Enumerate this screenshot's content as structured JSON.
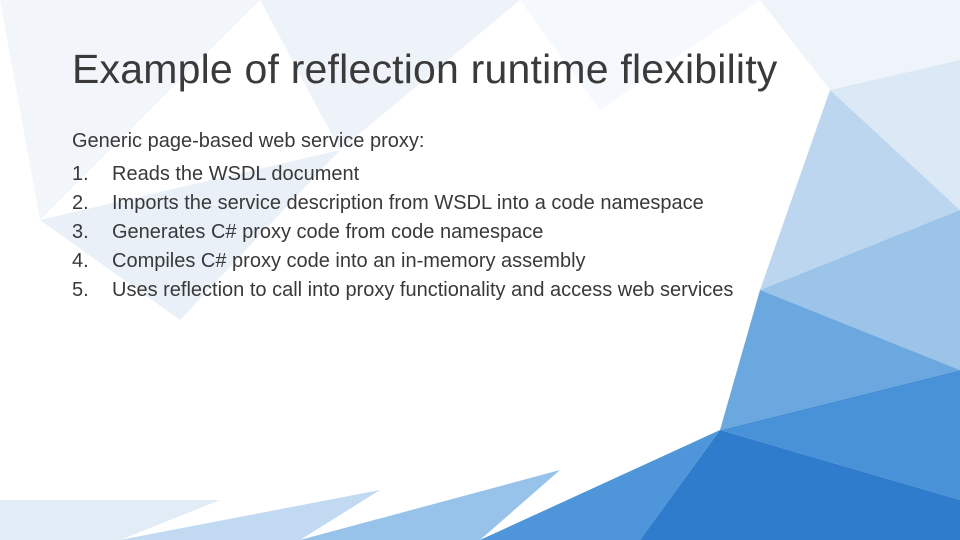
{
  "slide": {
    "title": "Example of reflection runtime flexibility",
    "intro": "Generic page-based web service proxy:",
    "items": [
      "Reads the WSDL document",
      "Imports the service description from WSDL into a code namespace",
      "Generates C# proxy code from code namespace",
      "Compiles C# proxy code into an in-memory assembly",
      "Uses reflection to call into proxy functionality and access web services"
    ],
    "theme": {
      "facet_light": "#e8eef6",
      "facet_mid": "#cfe0f2",
      "facet_blue1": "#7fb3e6",
      "facet_blue2": "#3e8ddd",
      "facet_blue3": "#2b73c4"
    }
  }
}
